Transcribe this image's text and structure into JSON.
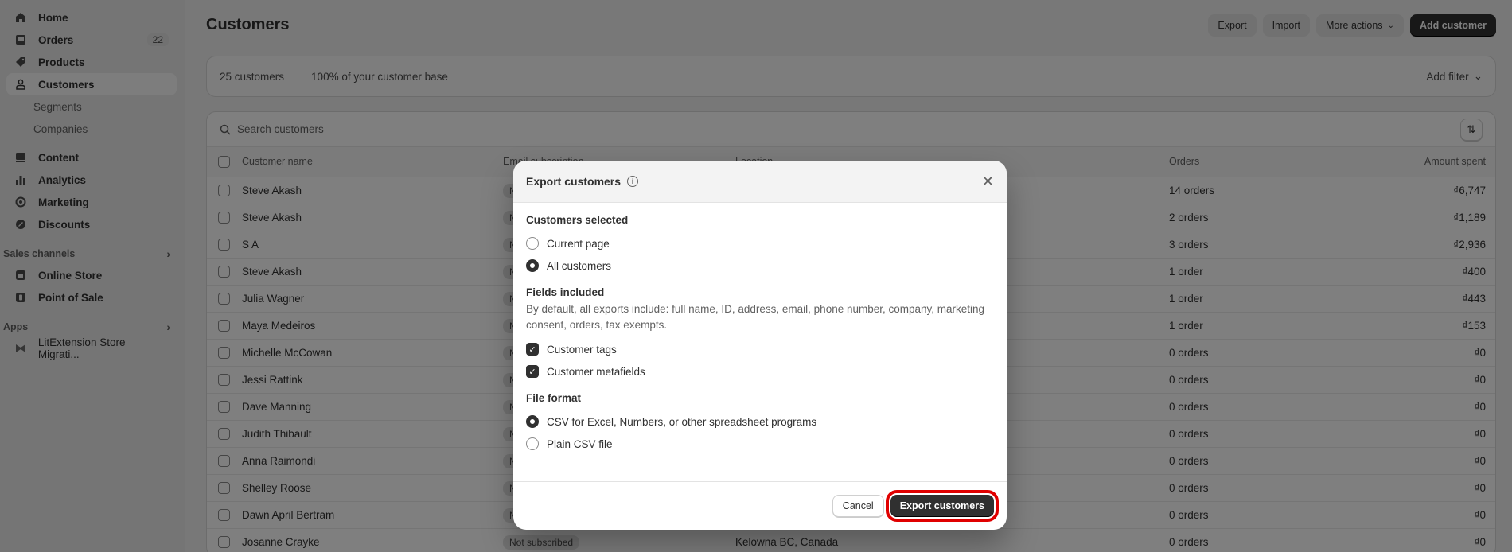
{
  "sidebar": {
    "items": [
      {
        "label": "Home",
        "icon": "home-icon"
      },
      {
        "label": "Orders",
        "icon": "inbox-icon",
        "badge": "22"
      },
      {
        "label": "Products",
        "icon": "tag-icon"
      },
      {
        "label": "Customers",
        "icon": "person-icon",
        "active": true
      }
    ],
    "customer_sub": [
      "Segments",
      "Companies"
    ],
    "items2": [
      {
        "label": "Content",
        "icon": "image-icon"
      },
      {
        "label": "Analytics",
        "icon": "bar-chart-icon"
      },
      {
        "label": "Marketing",
        "icon": "target-icon"
      },
      {
        "label": "Discounts",
        "icon": "discount-icon"
      }
    ],
    "sales_channels": {
      "title": "Sales channels",
      "items": [
        {
          "label": "Online Store",
          "icon": "store-icon"
        },
        {
          "label": "Point of Sale",
          "icon": "pos-icon"
        }
      ]
    },
    "apps": {
      "title": "Apps",
      "items": [
        {
          "label": "LitExtension Store Migrati...",
          "icon": "app-icon"
        }
      ]
    }
  },
  "header": {
    "title": "Customers",
    "actions": {
      "export": "Export",
      "import": "Import",
      "more": "More actions",
      "add": "Add customer"
    }
  },
  "stats": {
    "count": "25 customers",
    "base": "100% of your customer base",
    "add_filter": "Add filter"
  },
  "search": {
    "placeholder": "Search customers"
  },
  "table": {
    "columns": [
      "Customer name",
      "Email subscription",
      "Location",
      "Orders",
      "Amount spent"
    ],
    "rows": [
      {
        "name": "Steve Akash",
        "email": "Not subscribed",
        "location": "",
        "orders": "14 orders",
        "amount": "₫6,747"
      },
      {
        "name": "Steve Akash",
        "email": "Not subscribed",
        "location": "",
        "orders": "2 orders",
        "amount": "₫1,189"
      },
      {
        "name": "S A",
        "email": "Not subscribed",
        "location": "",
        "orders": "3 orders",
        "amount": "₫2,936"
      },
      {
        "name": "Steve Akash",
        "email": "Not subscribed",
        "location": "",
        "orders": "1 order",
        "amount": "₫400"
      },
      {
        "name": "Julia Wagner",
        "email": "Not subscribed",
        "location": "",
        "orders": "1 order",
        "amount": "₫443"
      },
      {
        "name": "Maya Medeiros",
        "email": "Not subscribed",
        "location": "",
        "orders": "1 order",
        "amount": "₫153"
      },
      {
        "name": "Michelle McCowan",
        "email": "Not subscribed",
        "location": "",
        "orders": "0 orders",
        "amount": "₫0"
      },
      {
        "name": "Jessi Rattink",
        "email": "Not subscribed",
        "location": "",
        "orders": "0 orders",
        "amount": "₫0"
      },
      {
        "name": "Dave Manning",
        "email": "Not subscribed",
        "location": "",
        "orders": "0 orders",
        "amount": "₫0"
      },
      {
        "name": "Judith Thibault",
        "email": "Not subscribed",
        "location": "",
        "orders": "0 orders",
        "amount": "₫0"
      },
      {
        "name": "Anna Raimondi",
        "email": "Not subscribed",
        "location": "",
        "orders": "0 orders",
        "amount": "₫0"
      },
      {
        "name": "Shelley Roose",
        "email": "Not subscribed",
        "location": "",
        "orders": "0 orders",
        "amount": "₫0"
      },
      {
        "name": "Dawn April Bertram",
        "email": "Not subscribed",
        "location": "",
        "orders": "0 orders",
        "amount": "₫0"
      },
      {
        "name": "Josanne Crayke",
        "email": "Not subscribed",
        "location": "Kelowna BC, Canada",
        "orders": "0 orders",
        "amount": "₫0"
      }
    ]
  },
  "modal": {
    "title": "Export customers",
    "customers_selected": {
      "title": "Customers selected",
      "options": [
        {
          "label": "Current page",
          "selected": false
        },
        {
          "label": "All customers",
          "selected": true
        }
      ]
    },
    "fields_included": {
      "title": "Fields included",
      "description": "By default, all exports include: full name, ID, address, email, phone number, company, marketing consent, orders, tax exempts.",
      "checkboxes": [
        {
          "label": "Customer tags",
          "checked": true
        },
        {
          "label": "Customer metafields",
          "checked": true
        }
      ]
    },
    "file_format": {
      "title": "File format",
      "options": [
        {
          "label": "CSV for Excel, Numbers, or other spreadsheet programs",
          "selected": true
        },
        {
          "label": "Plain CSV file",
          "selected": false
        }
      ]
    },
    "cancel": "Cancel",
    "export": "Export customers"
  },
  "colors": {
    "highlight": "#e00000",
    "primary": "#303030"
  }
}
